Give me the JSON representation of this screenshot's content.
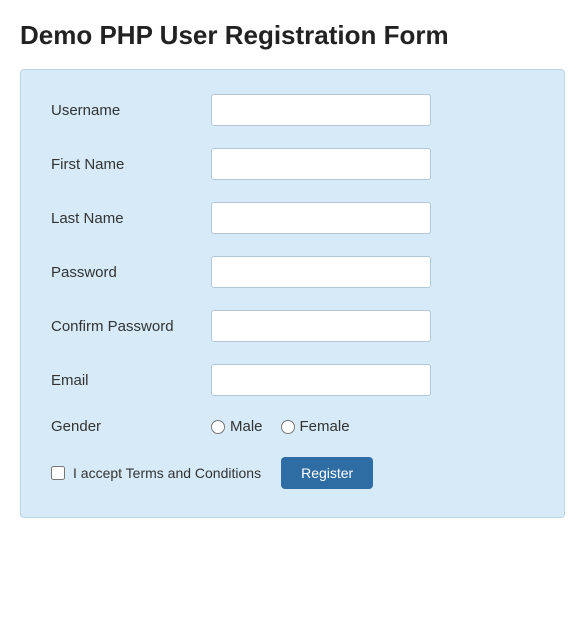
{
  "page": {
    "title": "Demo PHP User Registration Form"
  },
  "form": {
    "fields": [
      {
        "id": "username",
        "label": "Username",
        "type": "text",
        "placeholder": ""
      },
      {
        "id": "firstname",
        "label": "First Name",
        "type": "text",
        "placeholder": ""
      },
      {
        "id": "lastname",
        "label": "Last Name",
        "type": "text",
        "placeholder": ""
      },
      {
        "id": "password",
        "label": "Password",
        "type": "password",
        "placeholder": ""
      },
      {
        "id": "confirm_password",
        "label": "Confirm Password",
        "type": "password",
        "placeholder": ""
      },
      {
        "id": "email",
        "label": "Email",
        "type": "text",
        "placeholder": ""
      }
    ],
    "gender": {
      "label": "Gender",
      "options": [
        "Male",
        "Female"
      ]
    },
    "terms_label": "I accept Terms and Conditions",
    "register_button": "Register"
  }
}
